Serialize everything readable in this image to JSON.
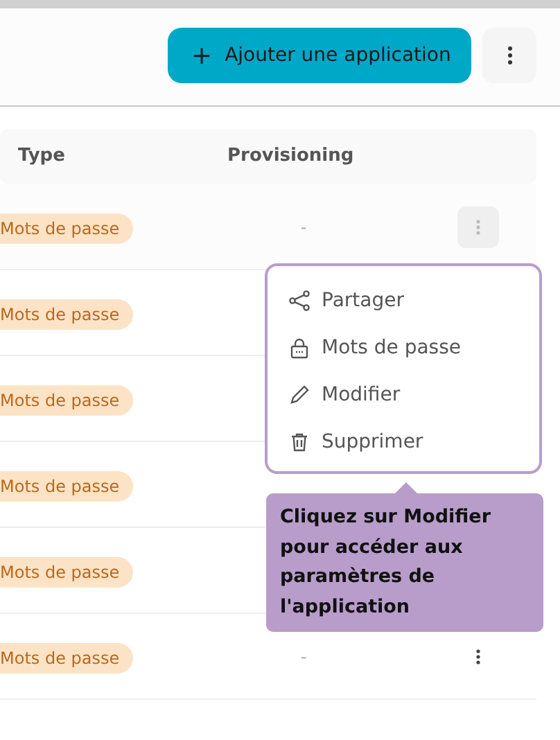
{
  "header": {
    "add_button": "Ajouter une application",
    "add_icon": "+"
  },
  "table": {
    "columns": [
      "Type",
      "Provisioning"
    ],
    "rows": [
      {
        "type": "Mots de passe",
        "provisioning": "-",
        "actions_button": {
          "selected": true
        }
      },
      {
        "type": "Mots de passe"
      },
      {
        "type": "Mots de passe"
      },
      {
        "type": "Mots de passe"
      },
      {
        "type": "Mots de passe"
      },
      {
        "type": "Mots de passe",
        "provisioning": "-",
        "actions_button": {
          "selected": false
        }
      }
    ]
  },
  "menu": [
    {
      "kind": "share",
      "label": "Partager"
    },
    {
      "kind": "lock",
      "label": "Mots de passe"
    },
    {
      "kind": "edit",
      "label": "Modifier"
    },
    {
      "kind": "delete",
      "label": "Supprimer"
    }
  ],
  "tooltip": "Cliquez sur Modifier pour accéder aux paramètres de l'application"
}
